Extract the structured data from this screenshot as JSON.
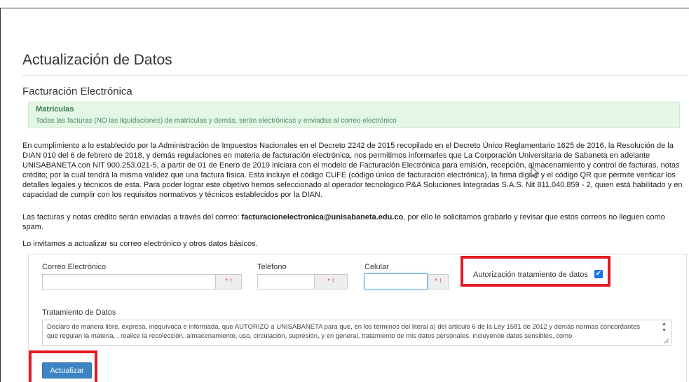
{
  "page": {
    "title": "Actualización de Datos",
    "section_title": "Facturación Electrónica"
  },
  "alert": {
    "title": "Matrículas",
    "text": "Todas las facturas (NO las liquidaciones) de matrículas y demás, serán electrónicas y enviadas al correo electrónico"
  },
  "intro": {
    "paragraph1": "En cumplimiento a lo establecido por la Administración de Impuestos Nacionales en el Decreto 2242 de 2015 recopilado en el Decreto Único Reglamentario 1625 de 2016, la Resolución de la DIAN 010 del 6 de febrero de 2018, y demás regulaciones en materia de facturación electrónica, nos permitimos informarles que La Corporación Universitaria de Sabaneta en adelante UNISABANETA con NIT 900.253.021-5, a partir de 01 de Enero de 2019 iniciara con el modelo de Facturación Electrónica para emisión, recepción, almacenamiento y control de facturas, notas crédito; por la cual tendrá la misma validez que una factura física. Esta incluye el código CUFE (código único de facturación electrónica), la firma digital y el código QR que permite verificar los detalles legales y técnicos de esta. Para poder lograr este objetivo hemos seleccionado al operador tecnológico P&A Soluciones Integradas S.A.S. Nit 811.040.859 - 2, quien está habilitado y en capacidad de cumplir con los requisitos normativos y técnicos establecidos por la DIAN.",
    "paragraph2_before": "Las facturas y notas crédito serán enviadas a través del correo: ",
    "paragraph2_email": "facturacionelectronica@unisabaneta.edu.co",
    "paragraph2_after": ", por ello le solicitamos grabarlo y revisar que estos correos no lleguen como spam.",
    "paragraph3": "Lo invitamos a actualizar su correo electrónico y otros datos básicos."
  },
  "form": {
    "email_label": "Correo Electrónico",
    "email_value": "",
    "phone_label": "Teléfono",
    "phone_value": "",
    "cell_label": "Celular",
    "cell_value": "",
    "required_marker": "* !",
    "authorization_label": "Autorización tratamiento de datos",
    "authorization_checked": true,
    "checkmark": "✔",
    "treatment_label": "Tratamiento de Datos",
    "treatment_text": "Declaro de manera libre, expresa, inequívoca e informada, que AUTORIZO a UNISABANETA para que, en los términos del literal a) del artículo 6 de la Ley 1581 de 2012 y demás normas concordantes que regulan la materia, , realice la recolección, almacenamiento, uso, circulación, supresión, y en general, tratamiento de mis datos personales, incluyendo datos sensibles, como",
    "scroll_up": "▲",
    "scroll_down": "▼",
    "submit_label": "Actualizar"
  },
  "colors": {
    "highlight_red": "#e31b23",
    "button_blue": "#3c84c4",
    "alert_green": "#e4f6e6"
  }
}
